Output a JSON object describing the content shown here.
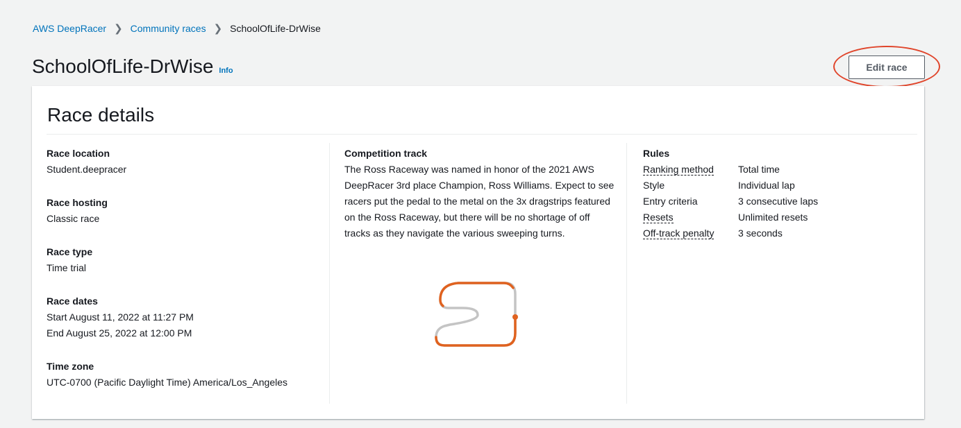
{
  "breadcrumb": {
    "items": [
      "AWS DeepRacer",
      "Community races"
    ],
    "current": "SchoolOfLife-DrWise",
    "separator": ">"
  },
  "page": {
    "title": "SchoolOfLife-DrWise",
    "info_label": "Info",
    "edit_button": "Edit race"
  },
  "panel": {
    "title": "Race details",
    "left": {
      "race_location": {
        "label": "Race location",
        "value": "Student.deepracer"
      },
      "race_hosting": {
        "label": "Race hosting",
        "value": "Classic race"
      },
      "race_type": {
        "label": "Race type",
        "value": "Time trial"
      },
      "race_dates": {
        "label": "Race dates",
        "start": "Start August 11, 2022 at 11:27 PM",
        "end": "End August 25, 2022 at 12:00 PM"
      },
      "time_zone": {
        "label": "Time zone",
        "value": "UTC-0700 (Pacific Daylight Time) America/Los_Angeles"
      }
    },
    "middle": {
      "label": "Competition track",
      "description": "The Ross Raceway was named in honor of the 2021 AWS DeepRacer 3rd place Champion, Ross Williams. Expect to see racers put the pedal to the metal on the 3x dragstrips featured on the Ross Raceway, but there will be no shortage of off tracks as they navigate the various sweeping turns."
    },
    "right": {
      "label": "Rules",
      "rows": [
        {
          "key": "Ranking method",
          "value": "Total time"
        },
        {
          "key": "Style",
          "value": "Individual lap"
        },
        {
          "key": "Entry criteria",
          "value": "3 consecutive laps"
        },
        {
          "key": "Resets",
          "value": "Unlimited resets"
        },
        {
          "key": "Off-track penalty",
          "value": "3 seconds"
        }
      ]
    }
  },
  "colors": {
    "link": "#0073bb",
    "track_orange": "#e0621f",
    "track_gray": "#c4c4c4",
    "highlight_ring": "#e0452b"
  }
}
